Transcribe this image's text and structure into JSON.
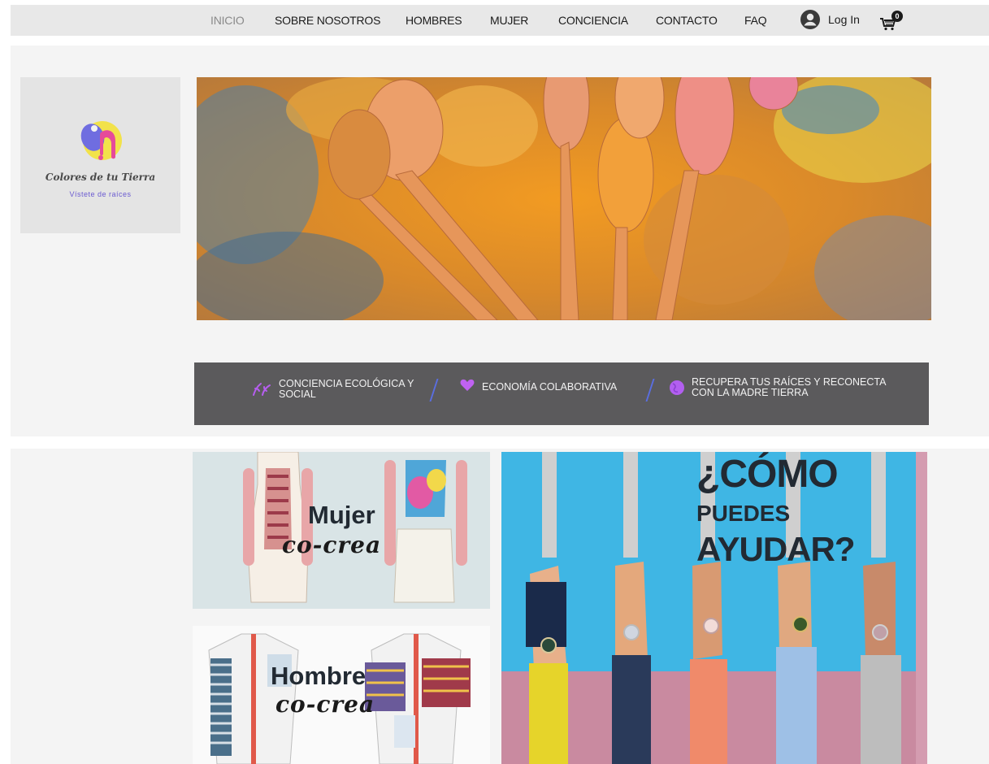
{
  "nav": {
    "items": [
      "INICIO",
      "SOBRE NOSOTROS",
      "HOMBRES",
      "MUJER",
      "CONCIENCIA",
      "CONTACTO",
      "FAQ"
    ],
    "active_index": 0,
    "login_label": "Log In",
    "cart_count": "0"
  },
  "logo": {
    "name": "Colores de tu Tierra",
    "tagline": "Vístete de raíces"
  },
  "strip": {
    "items": [
      {
        "line1": "CONCIENCIA ECOLÓGICA Y",
        "line2": "SOCIAL",
        "icon": "leaf-icon"
      },
      {
        "line1": "ECONOMÍA COLABORATIVA",
        "line2": "",
        "icon": "heart-hands-icon"
      },
      {
        "line1": "RECUPERA TUS RAÍCES Y RECONECTA",
        "line2": "CON LA MADRE TIERRA",
        "icon": "earth-icon"
      }
    ]
  },
  "cards": {
    "mujer": {
      "title": "Mujer",
      "script": "co-crea"
    },
    "hombre": {
      "title": "Hombre",
      "script": "co-crea"
    },
    "ayudar": {
      "line1": "¿CÓMO",
      "line2": "PUEDES",
      "line3": "AYUDAR?"
    }
  },
  "colors": {
    "nav_bg": "#e8e8e8",
    "strip_bg": "#5b5a5c",
    "accent_purple": "#a35ef0",
    "sky_blue": "#3fb6e4"
  }
}
